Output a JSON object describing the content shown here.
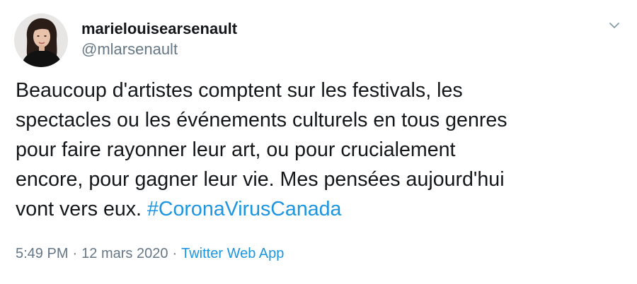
{
  "author": {
    "display_name": "marielouisearsenault",
    "handle": "@mlarsenault",
    "avatar_icon": "profile-photo"
  },
  "menu": {
    "icon": "chevron-down-icon"
  },
  "tweet": {
    "lines": [
      "Beaucoup d'artistes comptent sur les festivals, les",
      "spectacles ou les événements culturels en tous genres",
      "pour faire rayonner leur art, ou pour crucialement",
      "encore, pour gagner leur vie. Mes pensées aujourd'hui",
      "vont vers eux. "
    ],
    "hashtag": "#CoronaVirusCanada"
  },
  "meta": {
    "time": "5:49 PM",
    "separator": "·",
    "date": "12 mars 2020",
    "source": "Twitter Web App"
  },
  "colors": {
    "text": "#14171a",
    "secondary": "#657786",
    "link": "#1b95e0"
  }
}
